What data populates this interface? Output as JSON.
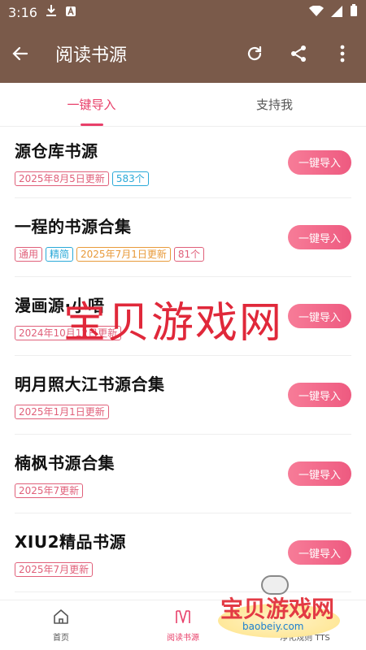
{
  "status": {
    "time": "3:16"
  },
  "app_bar": {
    "title": "阅读书源"
  },
  "tabs": [
    {
      "label": "一键导入",
      "active": true
    },
    {
      "label": "支持我",
      "active": false
    }
  ],
  "import_label": "一键导入",
  "items": [
    {
      "name": "源仓库书源",
      "tags": [
        {
          "text": "2025年8月5日更新",
          "color": "pink"
        },
        {
          "text": "583个",
          "color": "blue"
        }
      ]
    },
    {
      "name": "一程的书源合集",
      "tags": [
        {
          "text": "通用",
          "color": "pink"
        },
        {
          "text": "精简",
          "color": "blue"
        },
        {
          "text": "2025年7月1日更新",
          "color": "orange"
        },
        {
          "text": "81个",
          "color": "pink"
        }
      ]
    },
    {
      "name": "漫画源·小唔",
      "tags": [
        {
          "text": "2024年10月12日更新",
          "color": "pink"
        }
      ]
    },
    {
      "name": "明月照大江书源合集",
      "tags": [
        {
          "text": "2025年1月1日更新",
          "color": "pink"
        }
      ]
    },
    {
      "name": "楠枫书源合集",
      "tags": [
        {
          "text": "2025年7更新",
          "color": "pink"
        }
      ]
    },
    {
      "name": "XIU2精品书源",
      "tags": [
        {
          "text": "2025年7月更新",
          "color": "pink"
        }
      ]
    }
  ],
  "bottom_nav": [
    {
      "label": "首页",
      "icon": "home-icon",
      "active": false
    },
    {
      "label": "阅读书源",
      "icon": "book-source-icon",
      "active": true
    },
    {
      "label": "净化规则 TTS",
      "icon": "tts-icon",
      "active": false
    }
  ],
  "watermark": {
    "center_text": "宝贝游戏网",
    "corner_text": "宝贝游戏网",
    "corner_url": "baobeiy.com"
  },
  "colors": {
    "app_bar": "#7a5a4a",
    "accent": "#e8406a"
  }
}
